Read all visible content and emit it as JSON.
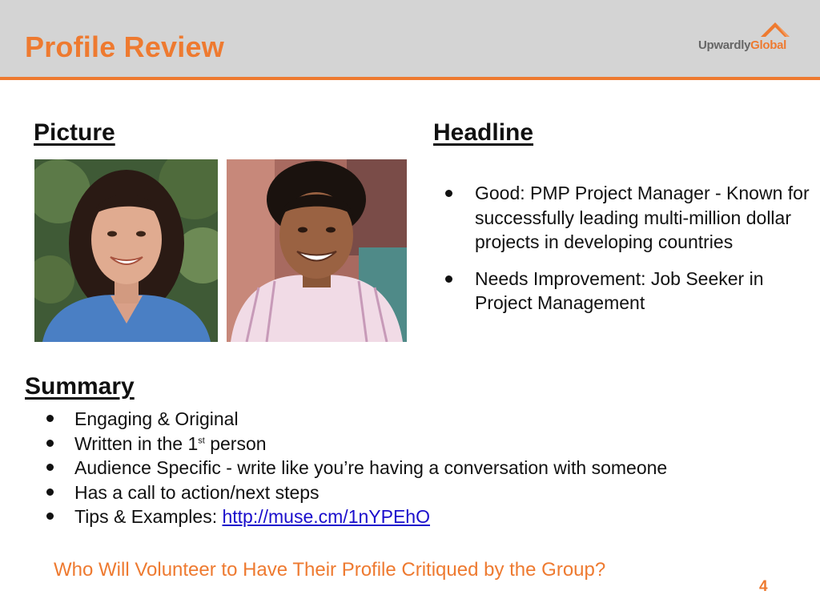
{
  "header": {
    "title": "Profile Review",
    "logo_text_part1": "Upwardly",
    "logo_text_part2": "Global",
    "accent_color": "#ee7a30",
    "bar_color": "#d4d4d4"
  },
  "picture": {
    "heading": "Picture"
  },
  "headline": {
    "heading": "Headline",
    "items": [
      "Good: PMP Project Manager - Known for successfully leading multi-million dollar projects in developing countries",
      "Needs Improvement: Job Seeker in Project Management"
    ]
  },
  "summary": {
    "heading": "Summary",
    "items": {
      "engaging": "Engaging & Original",
      "written_prefix": "Written in the 1",
      "written_sup": "st",
      "written_suffix": " person",
      "audience": "Audience Specific - write like you’re having a conversation with someone",
      "call_to_action": "Has a call to action/next steps",
      "tips_prefix": "Tips & Examples: ",
      "tips_link": "http://muse.cm/1nYPEhO"
    }
  },
  "footer": {
    "question": "Who Will Volunteer to Have Their Profile Critiqued by the Group?",
    "page_number": "4"
  }
}
